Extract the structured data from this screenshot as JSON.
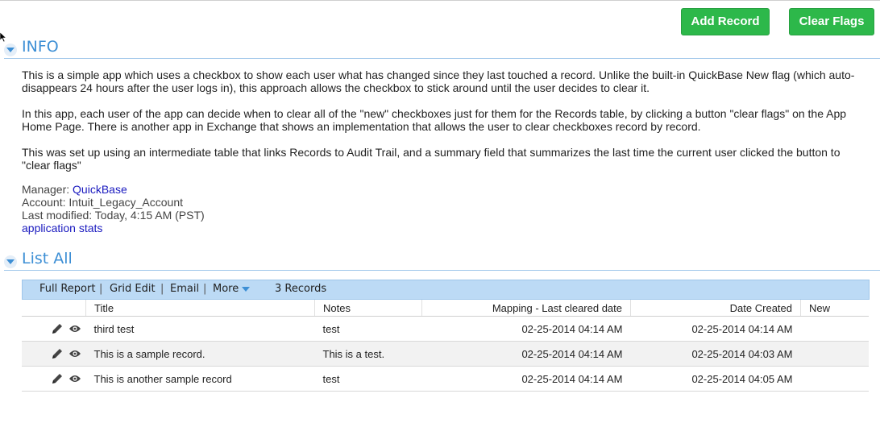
{
  "buttons": {
    "add_record": "Add Record",
    "clear_flags": "Clear Flags"
  },
  "colors": {
    "accent": "#3d8fd5",
    "button_green": "#2db84a",
    "toolbar_bg": "#bcdaf5",
    "link": "#1a1abf"
  },
  "info": {
    "title": "INFO",
    "paragraphs": [
      "This is a simple app which uses a checkbox to show each user what has changed since they last touched a record.  Unlike the built-in QuickBase New flag (which auto-disappears 24 hours after the user logs in), this approach allows the checkbox to stick around until the user decides to clear it.",
      "In this app, each user of the app can decide when to clear all of the \"new\" checkboxes just for them for the Records table, by clicking a button \"clear flags\" on the App Home Page.  There is another app in Exchange that shows an implementation that allows the user to clear checkboxes record by record.",
      "This was set up using an intermediate table that links Records to Audit Trail, and a summary field that summarizes the last time the current user clicked the button to \"clear flags\""
    ],
    "manager_label": "Manager:",
    "manager_value": "QuickBase",
    "account": "Account: Intuit_Legacy_Account",
    "last_modified": "Last modified: Today, 4:15 AM (PST)",
    "stats_link": "application stats"
  },
  "list": {
    "title": "List All",
    "toolbar": {
      "full_report": "Full Report",
      "grid_edit": "Grid Edit",
      "email": "Email",
      "more": "More",
      "sep": "|",
      "count": "3 Records"
    },
    "columns": [
      "Title",
      "Notes",
      "Mapping - Last cleared date",
      "Date Created",
      "New"
    ],
    "rows": [
      {
        "title": "third test",
        "notes": "test",
        "mapping": "02-25-2014 04:14 AM",
        "created": "02-25-2014 04:14 AM",
        "new": ""
      },
      {
        "title": "This is a sample record.",
        "notes": "This is a test.",
        "mapping": "02-25-2014 04:14 AM",
        "created": "02-25-2014 04:03 AM",
        "new": ""
      },
      {
        "title": "This is another sample record",
        "notes": "test",
        "mapping": "02-25-2014 04:14 AM",
        "created": "02-25-2014 04:05 AM",
        "new": ""
      }
    ]
  },
  "icons": {
    "edit": "pencil-icon",
    "view": "eye-icon",
    "collapse": "collapse-triangle-icon"
  }
}
